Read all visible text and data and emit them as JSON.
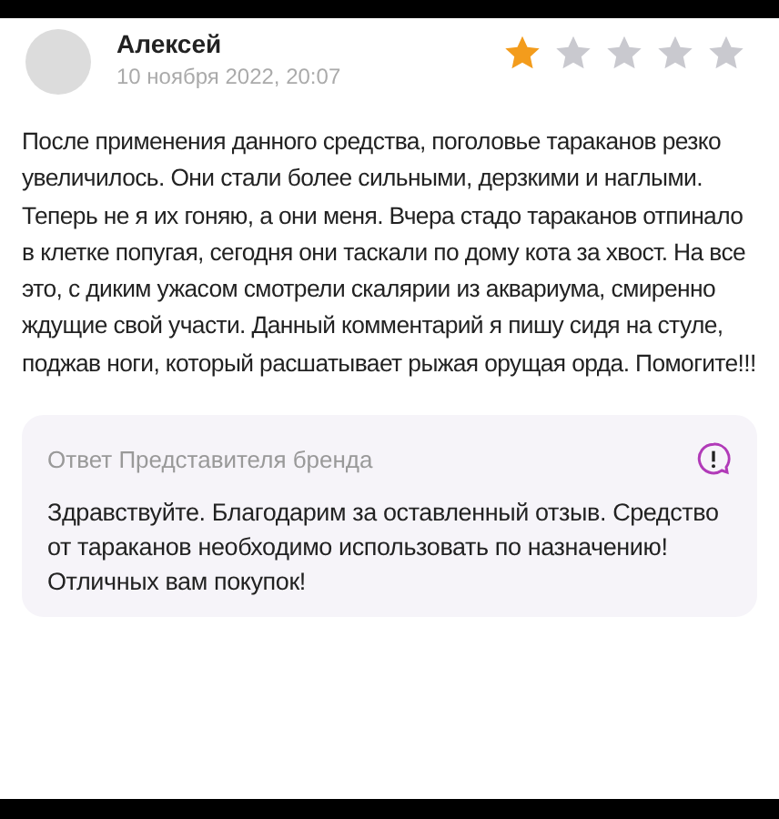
{
  "review": {
    "author": "Алексей",
    "date": "10 ноября 2022, 20:07",
    "stars": 1,
    "text": "После применения данного средства, поголовье тараканов резко увеличилось. Они стали более сильными, дерзкими и наглыми. Теперь не я их гоняю, а они меня. Вчера стадо тараканов отпинало в клетке попугая, сегодня они таскали по дому кота за хвост. На все это, с диким ужасом смотрели скалярии из аквариума, смиренно ждущие свой участи. Данный комментарий я пишу сидя на стуле, поджав ноги, который расшатывает рыжая орущая орда. Помогите!!!"
  },
  "reply": {
    "title": "Ответ Представителя бренда",
    "text": "Здравствуйте. Благодарим за оставленный отзыв. Средство от тараканов необходимо использовать по назначению! Отличных вам покупок!"
  }
}
